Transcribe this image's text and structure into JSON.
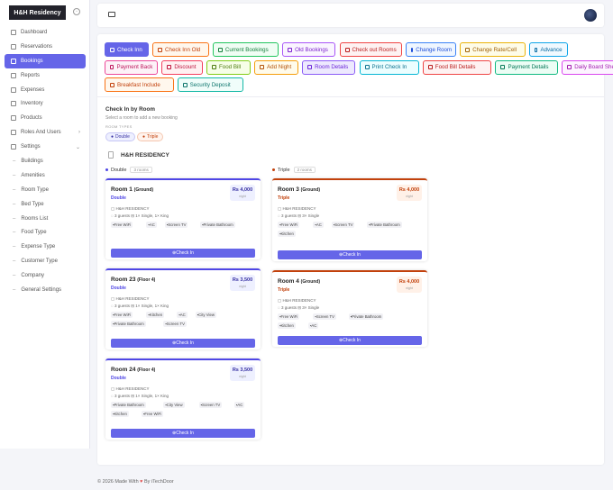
{
  "brand": {
    "name": "H&H Residency"
  },
  "colors": {
    "accent": "#6565e8",
    "blue": "#4f46e5",
    "red": "#c2410c"
  },
  "sidebar": {
    "items": [
      {
        "label": "Dashboard",
        "icon": "home-icon"
      },
      {
        "label": "Reservations",
        "icon": "calendar-icon"
      },
      {
        "label": "Bookings",
        "icon": "book-icon",
        "active": true
      },
      {
        "label": "Reports",
        "icon": "chart-icon"
      },
      {
        "label": "Expenses",
        "icon": "wallet-icon"
      },
      {
        "label": "Inventory",
        "icon": "box-icon"
      },
      {
        "label": "Products",
        "icon": "package-icon"
      },
      {
        "label": "Roles And Users",
        "icon": "users-icon",
        "chevron": ">"
      },
      {
        "label": "Settings",
        "icon": "gear-icon",
        "chevron": "v"
      }
    ],
    "subitems": [
      "Buildings",
      "Amenities",
      "Room Type",
      "Bed Type",
      "Rooms List",
      "Food Type",
      "Expense Type",
      "Customer Type",
      "Company",
      "General Settings"
    ]
  },
  "buttons": [
    {
      "label": "Check Inn",
      "color": "#6565e8",
      "bg": "#6565e8",
      "text": "#fff"
    },
    {
      "label": "Check Inn Old",
      "color": "#f97316",
      "bg": "#fff7ed",
      "text": "#c2410c"
    },
    {
      "label": "Current Bookings",
      "color": "#22c55e",
      "bg": "#f0fdf4",
      "text": "#15803d"
    },
    {
      "label": "Old Bookings",
      "color": "#a855f7",
      "bg": "#faf5ff",
      "text": "#7e22ce"
    },
    {
      "label": "Check out Rooms",
      "color": "#ef4444",
      "bg": "#fef2f2",
      "text": "#b91c1c"
    },
    {
      "label": "Change Room",
      "color": "#3b82f6",
      "bg": "#eff6ff",
      "text": "#1d4ed8"
    },
    {
      "label": "Change Rate/Cell",
      "color": "#eab308",
      "bg": "#fefce8",
      "text": "#a16207"
    },
    {
      "label": "Advance",
      "color": "#0ea5e9",
      "bg": "#f0f9ff",
      "text": "#0369a1"
    },
    {
      "label": "Payment Back",
      "color": "#ec4899",
      "bg": "#fdf2f8",
      "text": "#be185d"
    },
    {
      "label": "Discount",
      "color": "#f43f5e",
      "bg": "#fff1f2",
      "text": "#be123c"
    },
    {
      "label": "Food Bill",
      "color": "#84cc16",
      "bg": "#f7fee7",
      "text": "#4d7c0f"
    },
    {
      "label": "Add Night",
      "color": "#f59e0b",
      "bg": "#fffbeb",
      "text": "#b45309"
    },
    {
      "label": "Room Details",
      "color": "#8b5cf6",
      "bg": "#ede9fe",
      "text": "#6d28d9"
    },
    {
      "label": "Print Check In",
      "color": "#06b6d4",
      "bg": "#ecfeff",
      "text": "#0e7490"
    },
    {
      "label": "Food Bill Details",
      "color": "#ef4444",
      "bg": "#fef2f2",
      "text": "#b91c1c"
    },
    {
      "label": "Payment Details",
      "color": "#10b981",
      "bg": "#ecfdf5",
      "text": "#047857"
    },
    {
      "label": "Daily Board Sheet",
      "color": "#d946ef",
      "bg": "#fdf4ff",
      "text": "#a21caf"
    },
    {
      "label": "Breakfast Include",
      "color": "#f97316",
      "bg": "#fff7ed",
      "text": "#c2410c"
    },
    {
      "label": "Security Deposit",
      "color": "#14b8a6",
      "bg": "#f0fdfa",
      "text": "#0f766e"
    }
  ],
  "section": {
    "title": "Check In by Room",
    "subtitle": "Select a room to add a new booking",
    "room_types_label": "ROOM TYPES",
    "types": [
      "Double",
      "Triple"
    ]
  },
  "property": "H&H RESIDENCY",
  "columns": [
    {
      "name": "Double",
      "count": "3 rooms",
      "color": "#4f46e5",
      "rooms": [
        {
          "name": "Room 1",
          "floor": "(Ground)",
          "type": "Double",
          "price": "Rs 4,000",
          "per": "night",
          "hotel": "H&H RESIDENCY",
          "guests": "3 guests",
          "beds": "1× Single, 1× King",
          "amenities": [
            "Free WiFi",
            "AC",
            "Screen TV",
            "Private Bathroom"
          ],
          "action": "Check In"
        },
        {
          "name": "Room 23",
          "floor": "(Floor 4)",
          "type": "Double",
          "price": "Rs 3,500",
          "per": "night",
          "hotel": "H&H RESIDENCY",
          "guests": "3 guests",
          "beds": "1× Single, 1× King",
          "amenities": [
            "Free WiFi",
            "Kitchen",
            "AC",
            "City View",
            "Private Bathroom",
            "Screen TV"
          ],
          "action": "Check In"
        },
        {
          "name": "Room 24",
          "floor": "(Floor 4)",
          "type": "Double",
          "price": "Rs 3,500",
          "per": "night",
          "hotel": "H&H RESIDENCY",
          "guests": "3 guests",
          "beds": "1× Single, 1× King",
          "amenities": [
            "Private Bathroom",
            "City View",
            "Screen TV",
            "AC",
            "Kitchen",
            "Free WiFi"
          ],
          "action": "Check In"
        }
      ]
    },
    {
      "name": "Triple",
      "count": "2 rooms",
      "color": "#c2410c",
      "rooms": [
        {
          "name": "Room 3",
          "floor": "(Ground)",
          "type": "Triple",
          "price": "Rs 4,000",
          "per": "night",
          "hotel": "H&H RESIDENCY",
          "guests": "3 guests",
          "beds": "3× Single",
          "amenities": [
            "Free WiFi",
            "AC",
            "Screen TV",
            "Private Bathroom",
            "Kitchen"
          ],
          "action": "Check In"
        },
        {
          "name": "Room 4",
          "floor": "(Ground)",
          "type": "Triple",
          "price": "Rs 4,000",
          "per": "night",
          "hotel": "H&H RESIDENCY",
          "guests": "3 guests",
          "beds": "3× Single",
          "amenities": [
            "Free WiFi",
            "Screen TV",
            "Private Bathroom",
            "Kitchen",
            "AC"
          ],
          "action": "Check In"
        }
      ]
    }
  ],
  "footer": {
    "pre": "© 2026 Made With",
    "heart": "♥",
    "post": "By iTechDoor"
  }
}
